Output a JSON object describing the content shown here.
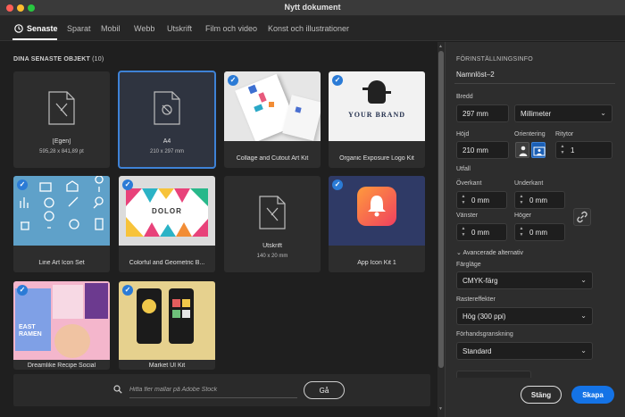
{
  "window": {
    "title": "Nytt dokument"
  },
  "tabs": [
    {
      "label": "Senaste",
      "active": true
    },
    {
      "label": "Sparat"
    },
    {
      "label": "Mobil"
    },
    {
      "label": "Webb"
    },
    {
      "label": "Utskrift"
    },
    {
      "label": "Film och video"
    },
    {
      "label": "Konst och illustrationer"
    }
  ],
  "recent": {
    "title": "DINA SENASTE OBJEKT",
    "count": "(10)",
    "items": [
      {
        "label": "[Egen]",
        "sub": "595,28 x 841,89 pt",
        "icon": "document-icon",
        "checked": false,
        "selected": false
      },
      {
        "label": "A4",
        "sub": "210 x 297 mm",
        "icon": "document-icon",
        "checked": false,
        "selected": true
      },
      {
        "label": "Collage and Cutout Art Kit",
        "icon": "template-thumbnail",
        "checked": true,
        "selected": false
      },
      {
        "label": "Organic Exposure Logo Kit",
        "icon": "template-thumbnail",
        "thumb_text": "YOUR BRAND",
        "checked": true,
        "selected": false
      },
      {
        "label": "Line Art Icon Set",
        "icon": "template-thumbnail",
        "checked": true,
        "selected": false
      },
      {
        "label": "Colorful and Geometric B...",
        "icon": "template-thumbnail",
        "thumb_text": "DOLOR",
        "checked": true,
        "selected": false
      },
      {
        "label": "Utskrift",
        "sub": "140 x 20 mm",
        "icon": "document-icon",
        "checked": false,
        "selected": false
      },
      {
        "label": "App Icon Kit 1",
        "icon": "template-thumbnail",
        "checked": true,
        "selected": false
      },
      {
        "label": "Dreamlike Recipe Social",
        "icon": "template-thumbnail",
        "thumb_text": "EAST RAMEN",
        "checked": true,
        "selected": false
      },
      {
        "label": "Market UI Kit",
        "icon": "template-thumbnail",
        "checked": true,
        "selected": false
      }
    ]
  },
  "search": {
    "placeholder": "Hitta fler mallar på Adobe Stock",
    "go_label": "Gå"
  },
  "settings": {
    "header": "FÖRINSTÄLLNINGSINFO",
    "doc_name": "Namnlöst–2",
    "width_label": "Bredd",
    "width_value": "297 mm",
    "unit_value": "Millimeter",
    "height_label": "Höjd",
    "height_value": "210 mm",
    "orientation_label": "Orientering",
    "artboards_label": "Ritytor",
    "artboards_value": "1",
    "bleed_label": "Utfall",
    "top_label": "Överkant",
    "top_value": "0 mm",
    "bottom_label": "Underkant",
    "bottom_value": "0 mm",
    "left_label": "Vänster",
    "left_value": "0 mm",
    "right_label": "Höger",
    "right_value": "0 mm",
    "advanced_label": "Avancerade alternativ",
    "color_mode_label": "Färgläge",
    "color_mode_value": "CMYK-färg",
    "raster_label": "Rastereffekter",
    "raster_value": "Hög (300 ppi)",
    "preview_label": "Förhandsgranskning",
    "preview_value": "Standard",
    "close_label": "Stäng",
    "create_label": "Skapa"
  },
  "colors": {
    "accent": "#1473e6",
    "selection": "#3e82d6",
    "check": "#2b7bd6"
  }
}
